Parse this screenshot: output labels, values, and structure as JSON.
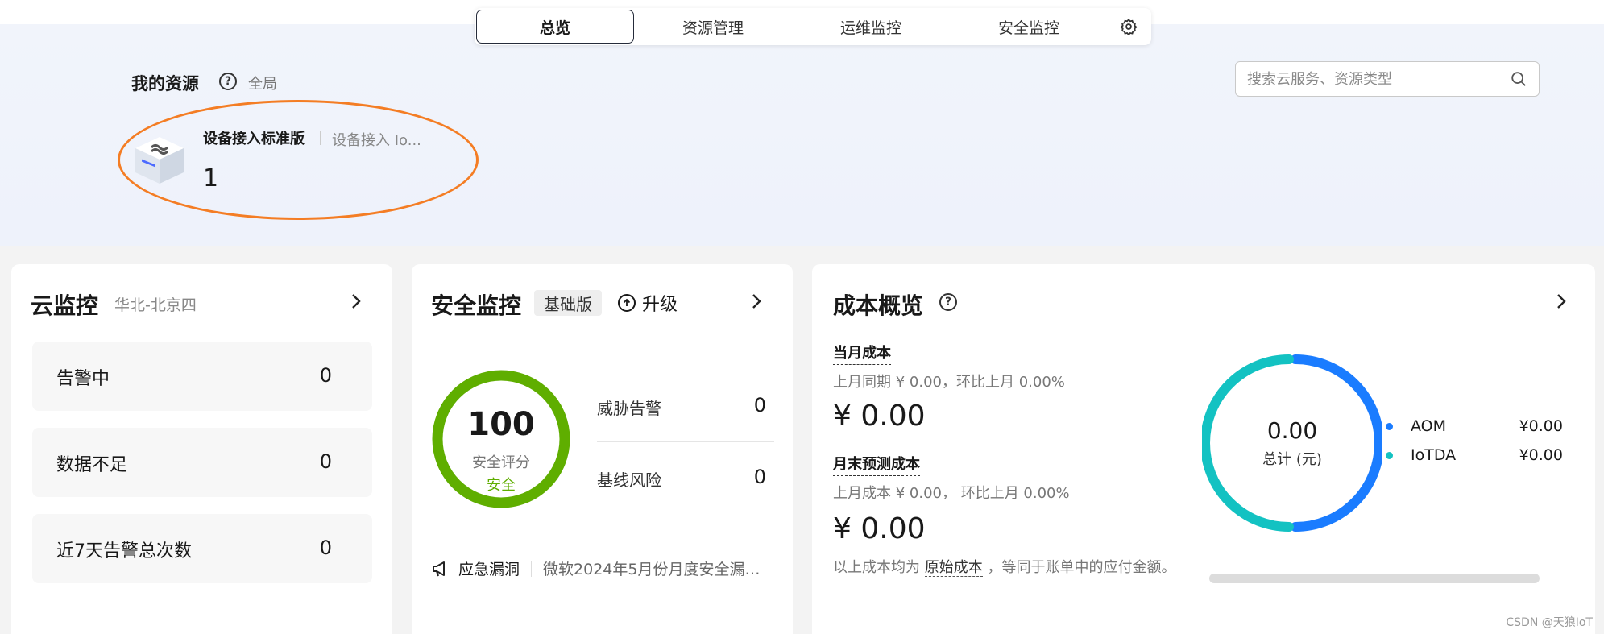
{
  "tabs": {
    "items": [
      {
        "label": "总览"
      },
      {
        "label": "资源管理"
      },
      {
        "label": "运维监控"
      },
      {
        "label": "安全监控"
      }
    ]
  },
  "resources": {
    "title": "我的资源",
    "scope": "全局",
    "card": {
      "name": "设备接入标准版",
      "subtitle": "设备接入 Io...",
      "count": "1"
    }
  },
  "search": {
    "placeholder": "搜索云服务、资源类型"
  },
  "cloud_monitor": {
    "title": "云监控",
    "region": "华北-北京四",
    "rows": [
      {
        "label": "告警中",
        "value": "0"
      },
      {
        "label": "数据不足",
        "value": "0"
      },
      {
        "label": "近7天告警总次数",
        "value": "0"
      }
    ]
  },
  "security": {
    "title": "安全监控",
    "edition": "基础版",
    "upgrade": "升级",
    "score": "100",
    "score_label": "安全评分",
    "score_status": "安全",
    "score_fraction": 1.0,
    "rows": [
      {
        "label": "威胁告警",
        "value": "0"
      },
      {
        "label": "基线风险",
        "value": "0"
      }
    ],
    "vuln_label": "应急漏洞",
    "vuln_text": "微软2024年5月份月度安全漏洞..."
  },
  "cost": {
    "title": "成本概览",
    "current_label": "当月成本",
    "current_sub": "上月同期 ¥ 0.00，环比上月  0.00%",
    "current_value": "¥ 0.00",
    "forecast_label": "月末预测成本",
    "forecast_sub": "上月成本 ¥ 0.00， 环比上月  0.00%",
    "forecast_value": "¥ 0.00",
    "note_prefix": "以上成本均为",
    "note_link": "原始成本",
    "note_suffix": "，等同于账单中的应付金额。",
    "donut_value": "0.00",
    "donut_label": "总计 (元)",
    "legend": [
      {
        "name": "AOM",
        "value": "¥0.00",
        "color": "#1a7cff"
      },
      {
        "name": "IoTDA",
        "value": "¥0.00",
        "color": "#13c2c2"
      }
    ]
  },
  "watermark": "CSDN @天狼IoT"
}
